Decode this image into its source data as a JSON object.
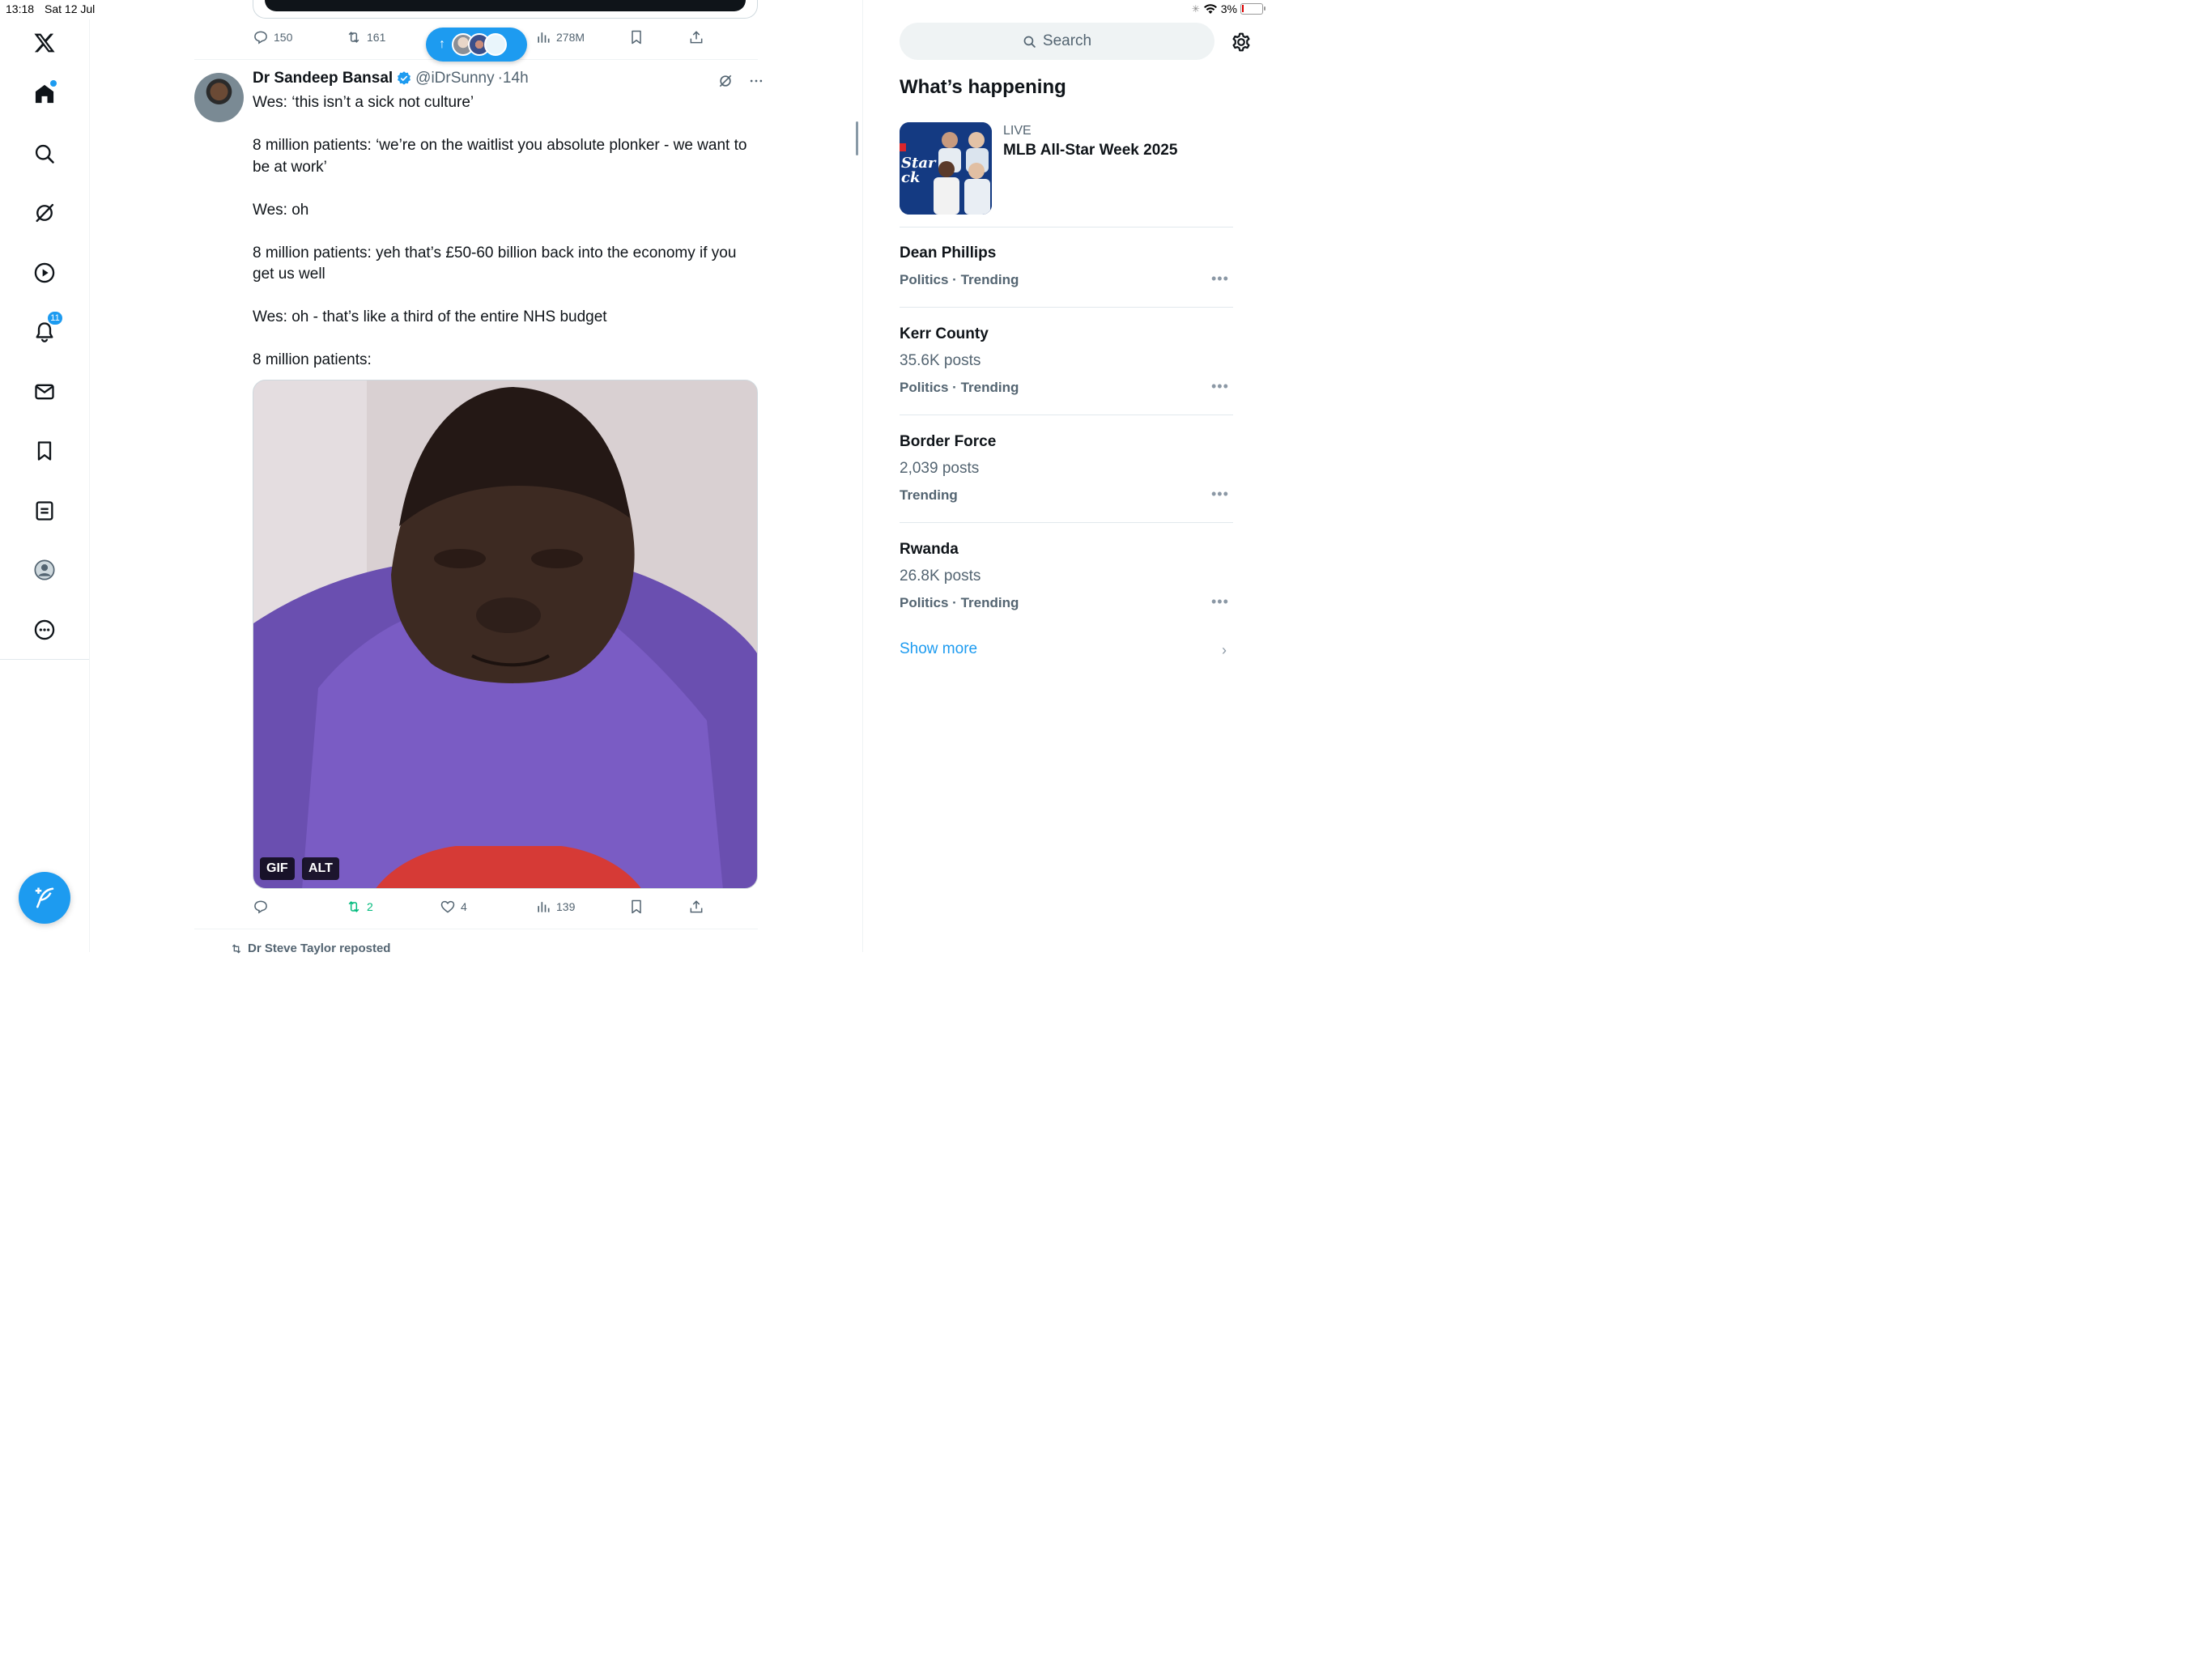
{
  "status_bar": {
    "time": "13:18",
    "date": "Sat 12 Jul",
    "battery": "3%"
  },
  "nav": {
    "notifications_badge": "11"
  },
  "prev_tweet": {
    "replies": "150",
    "retweets": "161",
    "views": "278M"
  },
  "new_posts_pill": {
    "arrow": "↑"
  },
  "tweet": {
    "name": "Dr Sandeep Bansal",
    "handle": "@iDrSunny",
    "time": "·14h",
    "lines": [
      "Wes: ‘this isn’t a sick not culture’",
      "8 million patients: ‘we’re on the waitlist you absolute plonker - we want to be at work’",
      "Wes: oh",
      "8 million patients: yeh that’s £50-60 billion back into the economy if you get us well",
      "Wes: oh - that’s like a third of the entire NHS budget",
      "8 million patients:"
    ],
    "media_badges": {
      "gif": "GIF",
      "alt": "ALT"
    },
    "retweets": "2",
    "likes": "4",
    "views": "139"
  },
  "next_item": {
    "retweet_label": "Dr Steve Taylor reposted"
  },
  "sidebar": {
    "search_placeholder": "Search",
    "heading": "What’s happening",
    "event": {
      "live": "LIVE",
      "title": "MLB All-Star Week 2025"
    },
    "trends": [
      {
        "name": "Dean Phillips",
        "posts": "",
        "category": "Politics · Trending"
      },
      {
        "name": "Kerr County",
        "posts": "35.6K posts",
        "category": "Politics · Trending"
      },
      {
        "name": "Border Force",
        "posts": "2,039 posts",
        "category": "Trending"
      },
      {
        "name": "Rwanda",
        "posts": "26.8K posts",
        "category": "Politics · Trending"
      }
    ],
    "show_more": "Show more"
  },
  "colors": {
    "accent": "#1d9bf0",
    "retweet_green": "#00ba7c",
    "text": "#0f1419",
    "muted": "#536471"
  }
}
